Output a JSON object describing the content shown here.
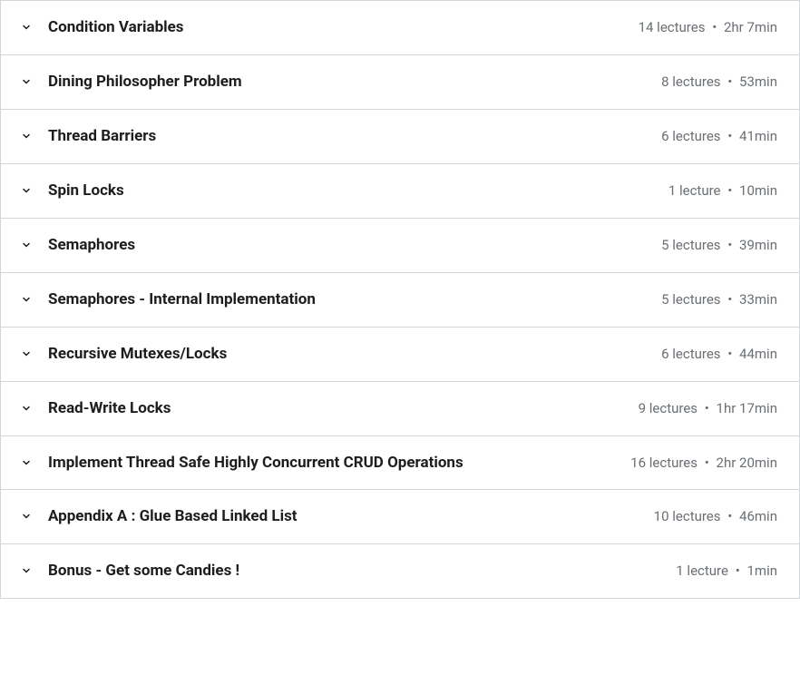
{
  "sections": [
    {
      "title": "Condition Variables",
      "lectures": "14 lectures",
      "duration": "2hr 7min"
    },
    {
      "title": "Dining Philosopher Problem",
      "lectures": "8 lectures",
      "duration": "53min"
    },
    {
      "title": "Thread Barriers",
      "lectures": "6 lectures",
      "duration": "41min"
    },
    {
      "title": "Spin Locks",
      "lectures": "1 lecture",
      "duration": "10min"
    },
    {
      "title": "Semaphores",
      "lectures": "5 lectures",
      "duration": "39min"
    },
    {
      "title": "Semaphores - Internal Implementation",
      "lectures": "5 lectures",
      "duration": "33min"
    },
    {
      "title": "Recursive Mutexes/Locks",
      "lectures": "6 lectures",
      "duration": "44min"
    },
    {
      "title": "Read-Write Locks",
      "lectures": "9 lectures",
      "duration": "1hr 17min"
    },
    {
      "title": "Implement Thread Safe Highly Concurrent CRUD Operations",
      "lectures": "16 lectures",
      "duration": "2hr 20min"
    },
    {
      "title": "Appendix A : Glue Based Linked List",
      "lectures": "10 lectures",
      "duration": "46min"
    },
    {
      "title": "Bonus - Get some Candies !",
      "lectures": "1 lecture",
      "duration": "1min"
    }
  ],
  "separator": "•"
}
